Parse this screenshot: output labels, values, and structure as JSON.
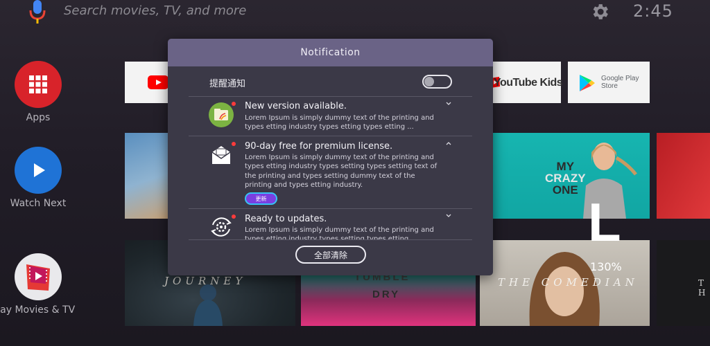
{
  "search": {
    "placeholder": "Search movies, TV, and more"
  },
  "clock": "2:45",
  "rail": {
    "apps_label": "Apps",
    "watch_next_label": "Watch Next",
    "play_movies_label": "Play Movies & TV"
  },
  "app_row": {
    "youtube_kids_label": "YouTube Kids",
    "google_play_line1": "Google Play",
    "google_play_line2": "Store"
  },
  "posters": {
    "journey": "JOURNEY",
    "tumble_dry_line1": "TUMBLE",
    "tumble_dry_line2": "DRY",
    "my_crazy_one_line1": "MY",
    "my_crazy_one_line2": "CRAZY",
    "my_crazy_one_line3": "ONE",
    "comedian": "THE COMEDIAN",
    "partial": "T H"
  },
  "overlay": {
    "letter": "L",
    "zoom": "130%"
  },
  "dialog": {
    "title": "Notification",
    "reminder_label": "提醒通知",
    "reminder_enabled": false,
    "notifications": [
      {
        "title": "New version available.",
        "body": "Lorem Ipsum is simply dummy text of the printing and types etting industry types etting types etting ...",
        "unread": true,
        "expanded": false
      },
      {
        "title": "90-day free for premium license.",
        "body": "Lorem Ipsum is simply dummy text of the printing and types etting industry types setting types setting text of the printing and types setting dummy text of the printing and types etting industry.",
        "unread": true,
        "expanded": true,
        "action_label": "更新"
      },
      {
        "title": "Ready to updates.",
        "body": "Lorem Ipsum is simply dummy text of the printing and types etting industry types setting types etting",
        "unread": true,
        "expanded": false
      }
    ],
    "clear_all_label": "全部清除"
  },
  "colors": {
    "dialog_header": "#6a6386",
    "dialog_body": "#3b3947",
    "unread_dot": "#ff3b3b",
    "update_button": "#7a3fe0",
    "update_button_border": "#37c3f4"
  }
}
